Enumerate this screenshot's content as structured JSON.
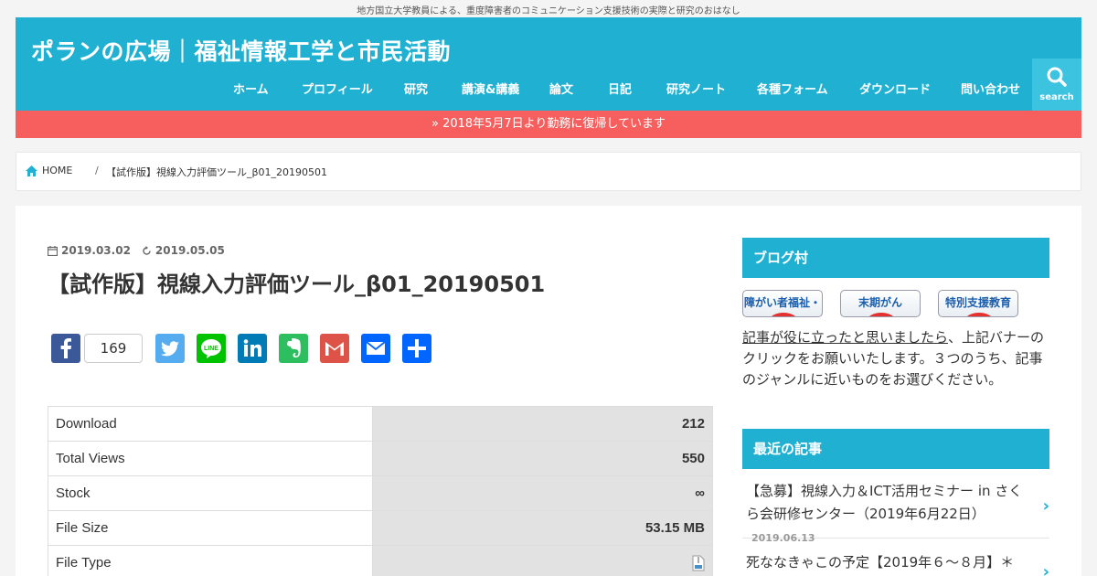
{
  "tagline": "地方国立大学教員による、重度障害者のコミュニケーション支援技術の実際と研究のおはなし",
  "site_title": "ポランの広場｜福祉情報工学と市民活動",
  "nav": [
    "ホーム",
    "プロフィール",
    "研究",
    "講演&講義",
    "論文",
    "日記",
    "研究ノート",
    "各種フォーム",
    "ダウンロード",
    "問い合わせ"
  ],
  "search_label": "search",
  "notice": "» 2018年5月7日より勤務に復帰しています",
  "breadcrumb": {
    "home": "HOME",
    "separator": "/",
    "current": "【試作版】視線入力評価ツール_β01_20190501"
  },
  "post": {
    "published": "2019.03.02",
    "updated": "2019.05.05",
    "title": "【試作版】視線入力評価ツール_β01_20190501"
  },
  "share": {
    "facebook_count": "169",
    "buttons": [
      "facebook",
      "twitter",
      "line",
      "linkedin",
      "evernote",
      "gmail",
      "email",
      "share"
    ]
  },
  "download_table": [
    {
      "key": "Download",
      "value": "212"
    },
    {
      "key": "Total Views",
      "value": "550"
    },
    {
      "key": "Stock",
      "value": "∞"
    },
    {
      "key": "File Size",
      "value": "53.15 MB"
    },
    {
      "key": "File Type",
      "value": ""
    }
  ],
  "sidebar": {
    "blogmura_title": "ブログ村",
    "banners": [
      "障がい者福祉・介護",
      "末期がん",
      "特別支援教育"
    ],
    "text_link": "記事が役に立ったと思いましたら",
    "text_rest": "、上記バナーのクリックをお願いいたします。３つのうち、記事のジャンルに近いものをお選びください。",
    "recent_title": "最近の記事",
    "recent": [
      {
        "title": "【急募】視線入力＆ICT活用セミナー in さくら会研修センター（2019年6月22日）",
        "date": "2019.06.13"
      },
      {
        "title": "死ななきゃこの予定【2019年６～８月】＊",
        "date": ""
      }
    ]
  },
  "colors": {
    "header": "#20b1d2",
    "notice": "#f65f5d",
    "search_box": "#3bc3e0"
  }
}
